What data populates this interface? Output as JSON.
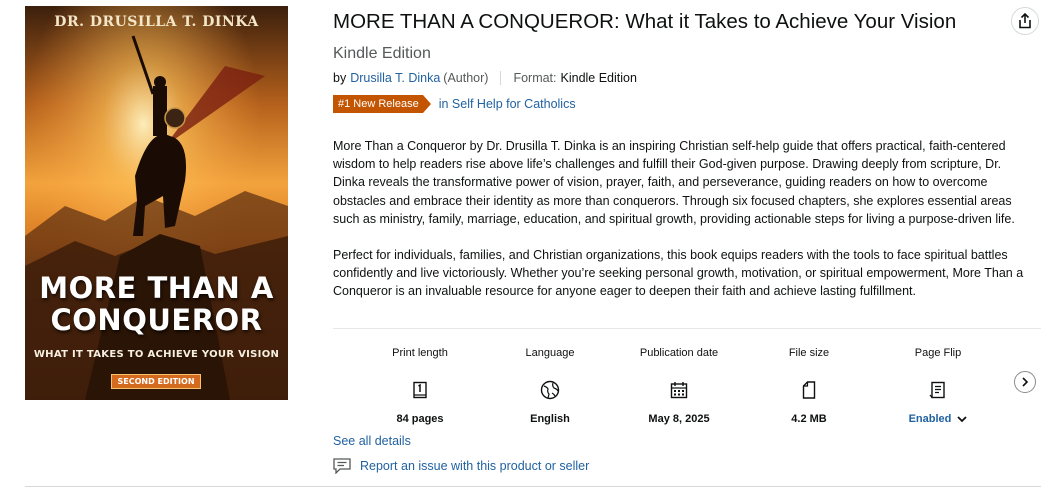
{
  "cover": {
    "author": "DR. DRUSILLA T. DINKA",
    "title_line1": "MORE THAN A",
    "title_line2": "CONQUEROR",
    "subtitle": "WHAT IT TAKES TO ACHIEVE YOUR VISION",
    "edition": "SECOND EDITION"
  },
  "product": {
    "title": "MORE THAN A CONQUEROR: What it Takes to Achieve Your Vision",
    "edition": "Kindle Edition",
    "by_label": "by",
    "author": "Drusilla T. Dinka",
    "author_role": "(Author)",
    "format_label": "Format:",
    "format_value": "Kindle Edition",
    "badge": "#1 New Release",
    "badge_category": "in Self Help for Catholics"
  },
  "description": {
    "para1": "More Than a Conqueror by Dr. Drusilla T. Dinka is an inspiring Christian self-help guide that offers practical, faith-centered wisdom to help readers rise above life’s challenges and fulfill their God-given purpose. Drawing deeply from scripture, Dr. Dinka reveals the transformative power of vision, prayer, faith, and perseverance, guiding readers on how to overcome obstacles and embrace their identity as more than conquerors. Through six focused chapters, she explores essential areas such as ministry, family, marriage, education, and spiritual growth, providing actionable steps for living a purpose-driven life.",
    "para2": "Perfect for individuals, families, and Christian organizations, this book equips readers with the tools to face spiritual battles confidently and live victoriously. Whether you’re seeking personal growth, motivation, or spiritual empowerment, More Than a Conqueror is an invaluable resource for anyone eager to deepen their faith and achieve lasting fulfillment."
  },
  "details": [
    {
      "label": "Print length",
      "value": "84 pages",
      "icon": "book-pages-icon"
    },
    {
      "label": "Language",
      "value": "English",
      "icon": "globe-icon"
    },
    {
      "label": "Publication date",
      "value": "May 8, 2025",
      "icon": "calendar-icon"
    },
    {
      "label": "File size",
      "value": "4.2 MB",
      "icon": "file-icon"
    },
    {
      "label": "Page Flip",
      "value": "Enabled",
      "icon": "page-flip-icon"
    }
  ],
  "links": {
    "see_all": "See all details",
    "report": "Report an issue with this product or seller"
  },
  "colors": {
    "link": "#2162a1",
    "badge": "#c45500",
    "text": "#0f1111",
    "muted": "#565959"
  }
}
